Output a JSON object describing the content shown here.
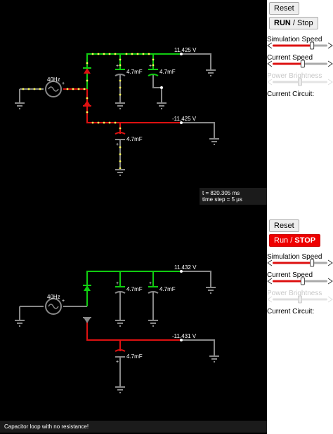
{
  "top": {
    "reset_label": "Reset",
    "run_label": "RUN",
    "run_sep": " / ",
    "stop_label": "Stop",
    "sim_speed_label": "Simulation Speed",
    "sim_speed": 0.72,
    "current_speed_label": "Current Speed",
    "current_speed": 0.55,
    "power_label": "Power Brightness",
    "power": 0.5,
    "circuit_label": "Current Circuit:",
    "source_label": "40Hz",
    "cap1_label": "4.7mF",
    "cap2_label": "4.7mF",
    "cap3_label": "4.7mF",
    "v_pos": "11.425 V",
    "v_neg": "-11.425 V",
    "time": "t = 820.305 ms",
    "timestep": "time step = 5 µs"
  },
  "bottom": {
    "reset_label": "Reset",
    "run_label": "Run",
    "run_sep": " / ",
    "stop_label": "STOP",
    "sim_speed_label": "Simulation Speed",
    "sim_speed": 0.72,
    "current_speed_label": "Current Speed",
    "current_speed": 0.55,
    "power_label": "Power Brightness",
    "power": 0.5,
    "circuit_label": "Current Circuit:",
    "source_label": "40Hz",
    "cap1_label": "4.7mF",
    "cap2_label": "4.7mF",
    "cap3_label": "4.7mF",
    "v_pos": "11.432 V",
    "v_neg": "-11.431 V",
    "status": "Capacitor loop with no resistance!"
  },
  "colors": {
    "pos": "#11cc11",
    "neg": "#dd1111",
    "gray": "#888888",
    "dot": "#ffff55",
    "stop_btn": "#ee0000"
  }
}
